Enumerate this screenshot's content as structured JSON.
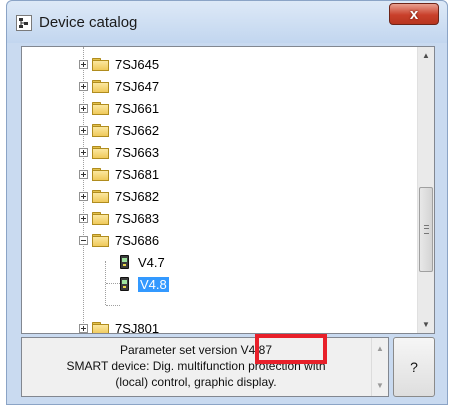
{
  "window": {
    "title": "Device catalog",
    "close_label": "x"
  },
  "tree": {
    "nodes": [
      {
        "label": "7SJ645",
        "expanded": false
      },
      {
        "label": "7SJ647",
        "expanded": false
      },
      {
        "label": "7SJ661",
        "expanded": false
      },
      {
        "label": "7SJ662",
        "expanded": false
      },
      {
        "label": "7SJ663",
        "expanded": false
      },
      {
        "label": "7SJ681",
        "expanded": false
      },
      {
        "label": "7SJ682",
        "expanded": false
      },
      {
        "label": "7SJ683",
        "expanded": false
      },
      {
        "label": "7SJ686",
        "expanded": true
      },
      {
        "label": "7SJ801",
        "expanded": false
      }
    ],
    "children": [
      {
        "label": "V4.7",
        "selected": false
      },
      {
        "label": "V4.8",
        "selected": true
      }
    ]
  },
  "info": {
    "line1": "Parameter set version V4.87",
    "line2": "SMART device: Dig. multifunction protection with",
    "line3": "(local) control, graphic display."
  },
  "help_label": "?",
  "colors": {
    "selection": "#3399ff",
    "highlight": "#e8202a",
    "close_button": "#c9402b"
  }
}
